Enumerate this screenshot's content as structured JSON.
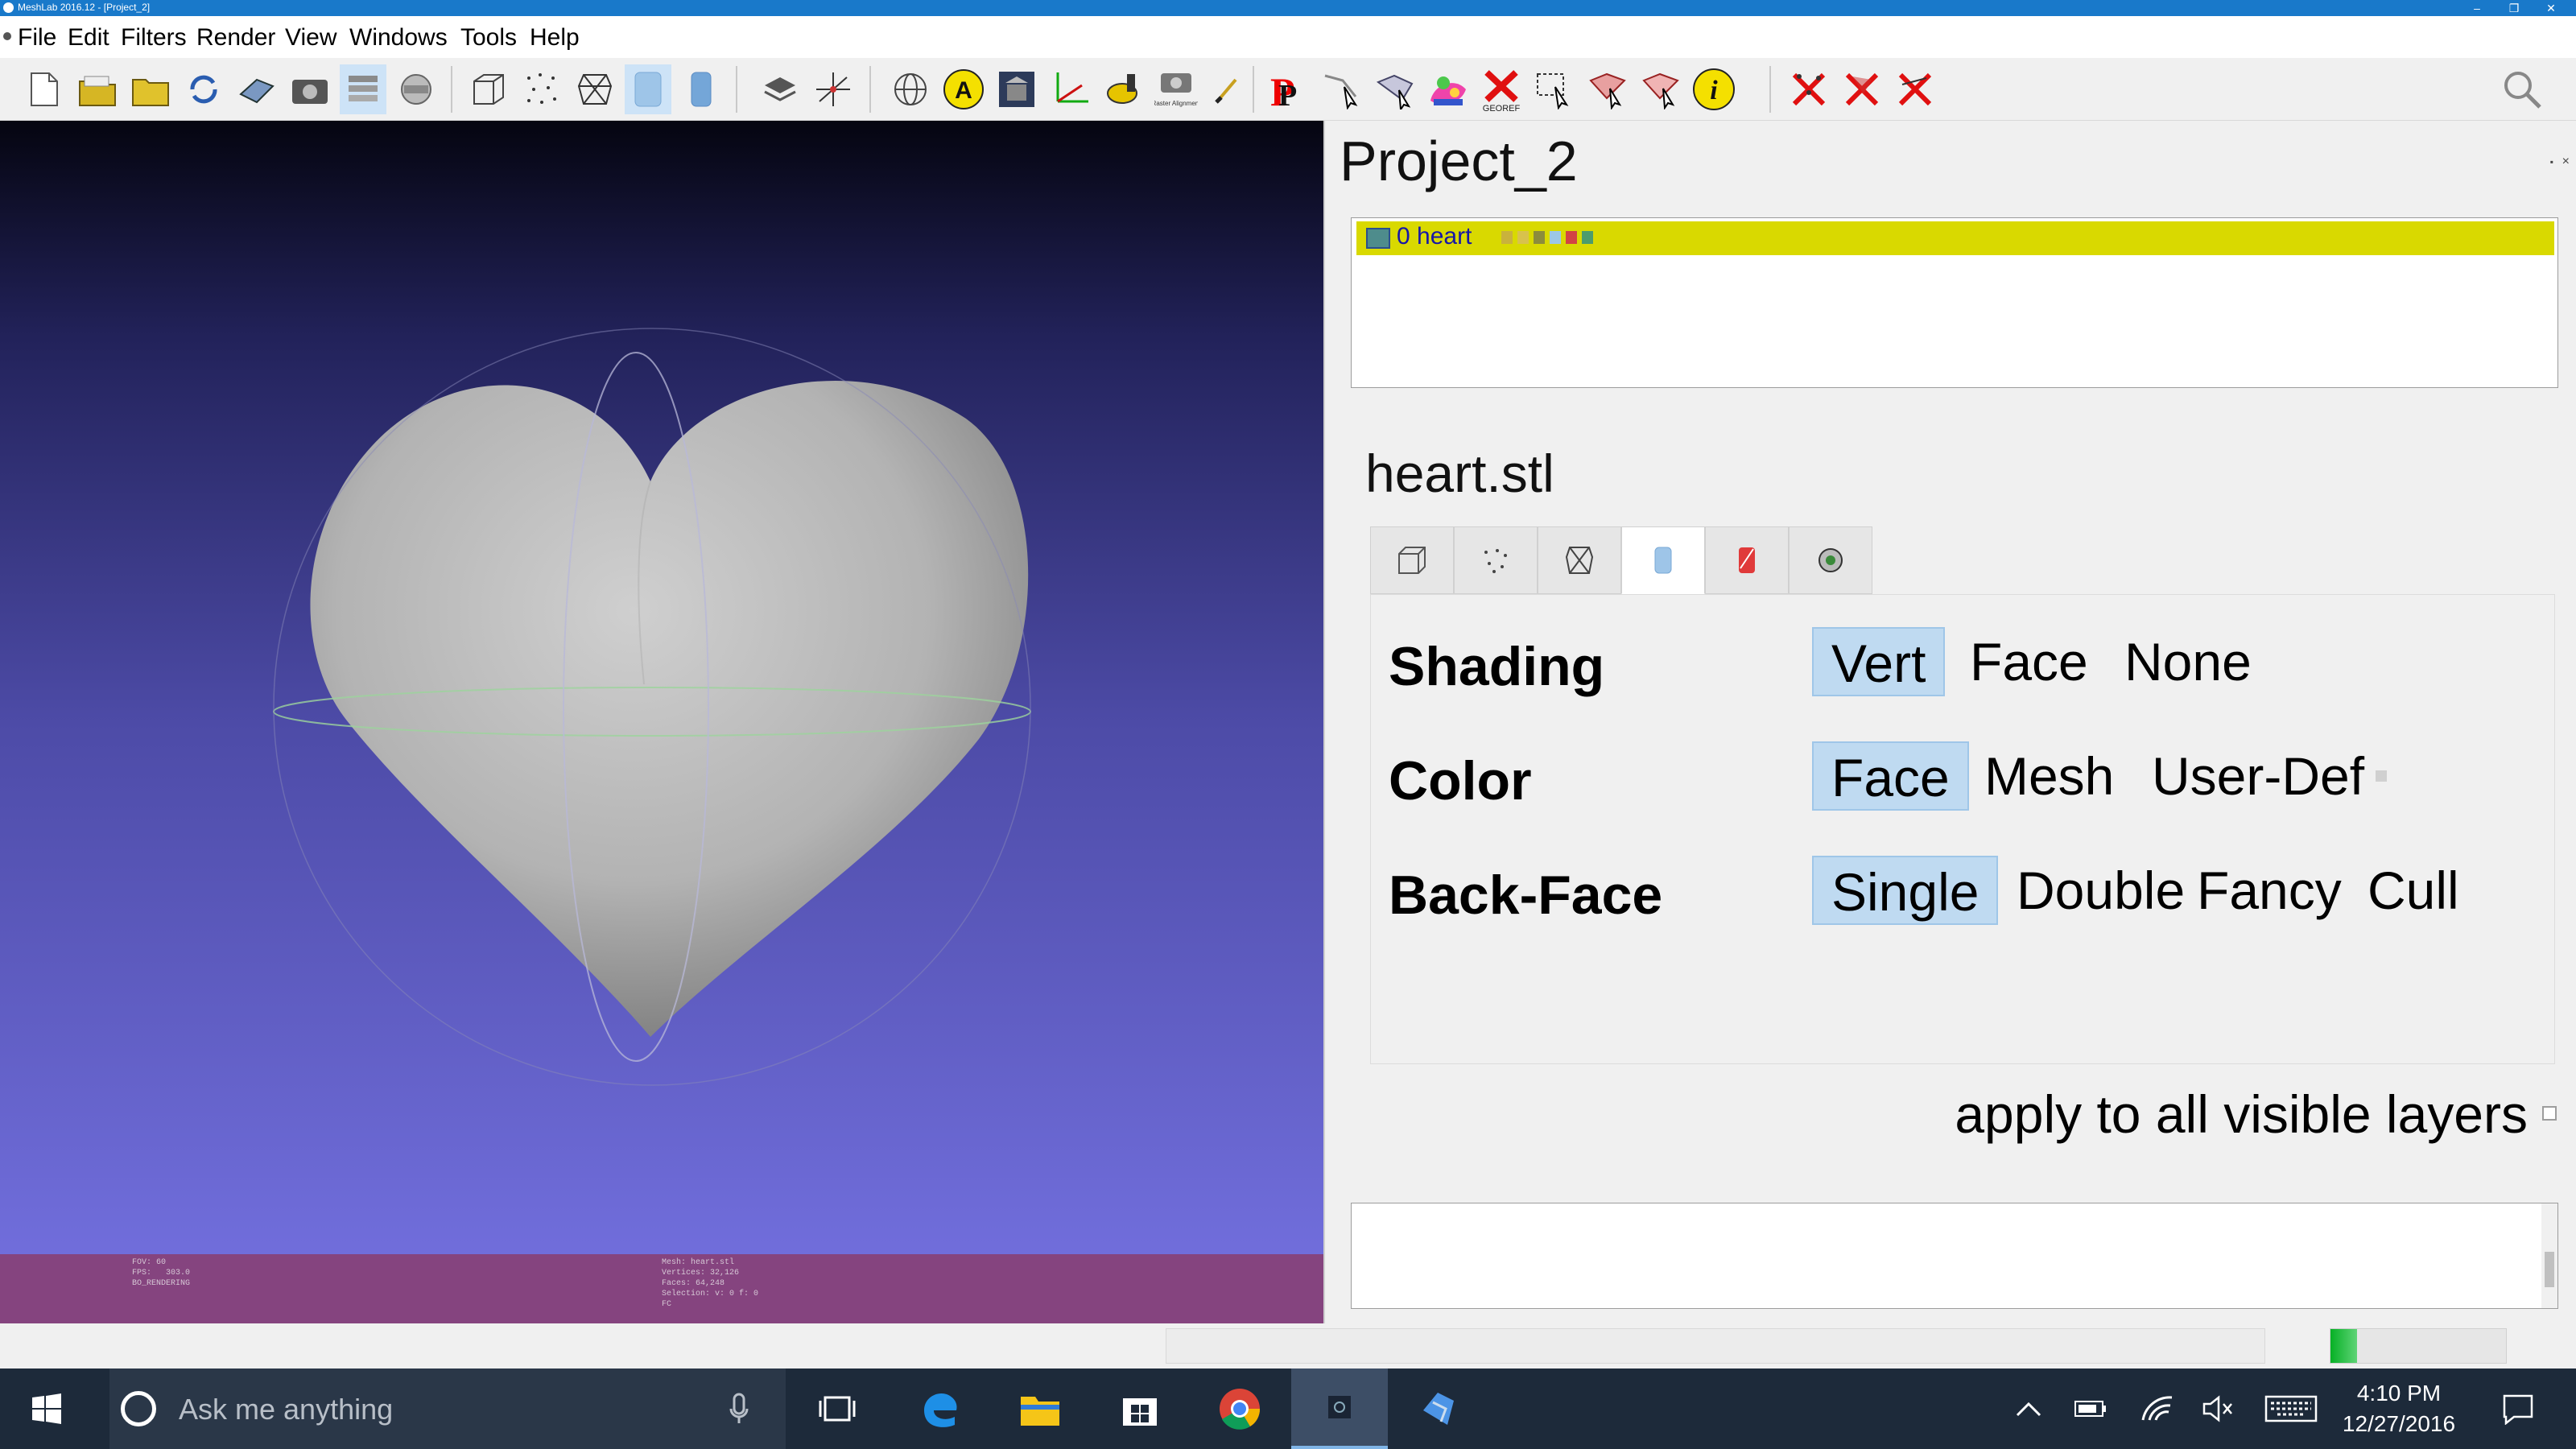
{
  "window": {
    "title": "MeshLab 2016.12 - [Project_2]"
  },
  "menu": [
    "File",
    "Edit",
    "Filters",
    "Render",
    "View",
    "Windows",
    "Tools",
    "Help"
  ],
  "toolbar": {
    "georef_label": "GEOREF",
    "raster_label": "Raster Alignment",
    "info_glyph": "i",
    "annotation_glyph": "A",
    "pick_glyph": "P"
  },
  "viewer": {
    "info_left": "FOV: 60\nFPS:   303.0\nBO_RENDERING",
    "info_mid": "Mesh: heart.stl\nVertices: 32,126\nFaces: 64,248\nSelection: v: 0 f: 0\nFC"
  },
  "panel": {
    "project_title": "Project_2",
    "float_icon": "▪",
    "close_icon": "×",
    "layer": {
      "name": "0 heart"
    },
    "mesh_title": "heart.stl",
    "tabs": [
      "box",
      "points",
      "wire",
      "flat",
      "texture",
      "misc"
    ],
    "options": {
      "shading": {
        "label": "Shading",
        "choices": [
          "Vert",
          "Face",
          "None"
        ],
        "selected": "Vert"
      },
      "color": {
        "label": "Color",
        "choices": [
          "Face",
          "Mesh",
          "User-Def"
        ],
        "selected": "Face"
      },
      "backface": {
        "label": "Back-Face",
        "choices": [
          "Single",
          "Double",
          "Fancy",
          "Cull"
        ],
        "selected": "Single"
      }
    },
    "apply_label": "apply to all visible layers"
  },
  "statusbar": {
    "progress": 0.15
  },
  "taskbar": {
    "search_placeholder": "Ask me anything",
    "time": "4:10 PM",
    "date": "12/27/2016",
    "pinned": [
      "task-view",
      "edge",
      "file-explorer",
      "store",
      "chrome",
      "meshlab",
      "blue-app"
    ]
  },
  "colors": {
    "accent": "#1979ca",
    "selected": "#bfdaf1",
    "layer_highlight": "#d9d900",
    "info_bar": "#85447f"
  }
}
